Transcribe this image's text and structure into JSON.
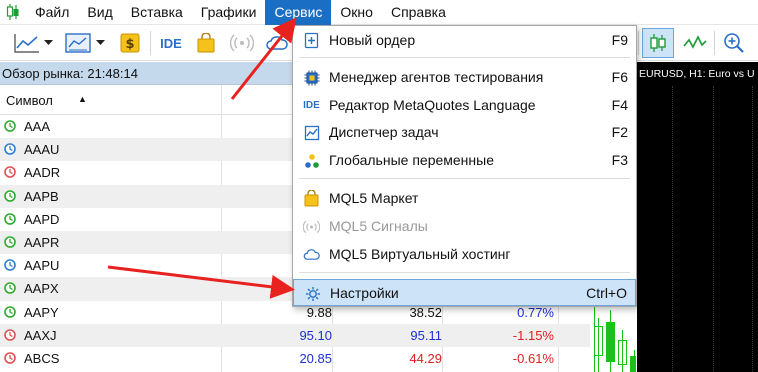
{
  "menubar": {
    "items": [
      {
        "label": "Файл"
      },
      {
        "label": "Вид"
      },
      {
        "label": "Вставка"
      },
      {
        "label": "Графики"
      },
      {
        "label": "Сервис"
      },
      {
        "label": "Окно"
      },
      {
        "label": "Справка"
      }
    ],
    "active_index": 4
  },
  "toolbar": {
    "ide_label": "IDE",
    "icons": [
      "line-chart-icon",
      "dropdown-arrow-icon",
      "chart-template-icon",
      "dropdown-arrow-icon",
      "dollar-icon",
      "ide-icon",
      "market-bag-icon",
      "signals-icon",
      "cloud-icon",
      "candlestick-icon",
      "zigzag-icon",
      "zoom-in-icon"
    ]
  },
  "market_watch": {
    "title": "Обзор рынка: 21:48:14",
    "column_symbol": "Символ",
    "rows": [
      {
        "symbol": "AAA",
        "icon_color": "#2cab2c",
        "bid": "",
        "ask": "",
        "change": "",
        "bid_class": "",
        "ask_class": "",
        "change_class": ""
      },
      {
        "symbol": "AAAU",
        "icon_color": "#2f7fd0",
        "bid": "",
        "ask": "",
        "change": "",
        "bid_class": "",
        "ask_class": "",
        "change_class": ""
      },
      {
        "symbol": "AADR",
        "icon_color": "#e05050",
        "bid": "",
        "ask": "",
        "change": "",
        "bid_class": "",
        "ask_class": "",
        "change_class": ""
      },
      {
        "symbol": "AAPB",
        "icon_color": "#2cab2c",
        "bid": "",
        "ask": "",
        "change": "",
        "bid_class": "",
        "ask_class": "",
        "change_class": ""
      },
      {
        "symbol": "AAPD",
        "icon_color": "#2cab2c",
        "bid": "",
        "ask": "",
        "change": "",
        "bid_class": "",
        "ask_class": "",
        "change_class": ""
      },
      {
        "symbol": "AAPR",
        "icon_color": "#2cab2c",
        "bid": "",
        "ask": "",
        "change": "",
        "bid_class": "",
        "ask_class": "",
        "change_class": ""
      },
      {
        "symbol": "AAPU",
        "icon_color": "#2f7fd0",
        "bid": "",
        "ask": "",
        "change": "",
        "bid_class": "",
        "ask_class": "",
        "change_class": ""
      },
      {
        "symbol": "AAPX",
        "icon_color": "#2cab2c",
        "bid": "",
        "ask": "",
        "change": "",
        "bid_class": "",
        "ask_class": "",
        "change_class": ""
      },
      {
        "symbol": "AAPY",
        "icon_color": "#2cab2c",
        "bid": "9.88",
        "ask": "38.52",
        "change": "0.77%",
        "bid_class": "black",
        "ask_class": "black",
        "change_class": "blue"
      },
      {
        "symbol": "AAXJ",
        "icon_color": "#e05050",
        "bid": "95.10",
        "ask": "95.11",
        "change": "-1.15%",
        "bid_class": "blue",
        "ask_class": "blue",
        "change_class": "red"
      },
      {
        "symbol": "ABCS",
        "icon_color": "#e05050",
        "bid": "20.85",
        "ask": "44.29",
        "change": "-0.61%",
        "bid_class": "blue",
        "ask_class": "red",
        "change_class": "red"
      }
    ]
  },
  "chart": {
    "title": "EURUSD, H1:  Euro vs U"
  },
  "service_menu": {
    "items": [
      {
        "label": "Новый ордер",
        "shortcut": "F9",
        "icon": "new-order-icon",
        "disabled": false,
        "highlighted": false
      },
      {
        "label": "Менеджер агентов тестирования",
        "shortcut": "F6",
        "icon": "agents-manager-icon",
        "disabled": false,
        "highlighted": false
      },
      {
        "label": "Редактор MetaQuotes Language",
        "shortcut": "F4",
        "icon": "ide-icon",
        "disabled": false,
        "highlighted": false
      },
      {
        "label": "Диспетчер задач",
        "shortcut": "F2",
        "icon": "task-manager-icon",
        "disabled": false,
        "highlighted": false
      },
      {
        "label": "Глобальные переменные",
        "shortcut": "F3",
        "icon": "global-variables-icon",
        "disabled": false,
        "highlighted": false
      },
      {
        "label": "MQL5 Маркет",
        "shortcut": "",
        "icon": "market-bag-icon",
        "disabled": false,
        "highlighted": false
      },
      {
        "label": "MQL5 Сигналы",
        "shortcut": "",
        "icon": "signals-icon",
        "disabled": true,
        "highlighted": false
      },
      {
        "label": "MQL5 Виртуальный хостинг",
        "shortcut": "",
        "icon": "cloud-icon",
        "disabled": false,
        "highlighted": false
      },
      {
        "label": "Настройки",
        "shortcut": "Ctrl+O",
        "icon": "gear-icon",
        "disabled": false,
        "highlighted": true
      }
    ],
    "ide_icon_text": "IDE"
  },
  "colors": {
    "menu_active": "#1a6fc4",
    "menu_highlight": "#cde3f7",
    "annotation_arrow": "#e8231f",
    "chart_background": "#000000",
    "candle": "#18c218"
  }
}
